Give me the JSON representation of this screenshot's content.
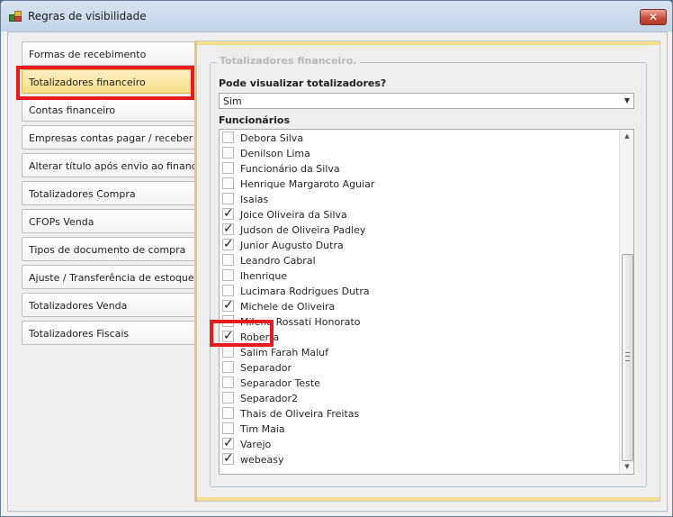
{
  "window": {
    "title": "Regras de visibilidade",
    "close_label": "✕"
  },
  "nav": {
    "items": [
      {
        "label": "Formas de recebimento"
      },
      {
        "label": "Totalizadores financeiro"
      },
      {
        "label": "Contas financeiro"
      },
      {
        "label": "Empresas contas pagar / receber"
      },
      {
        "label": "Alterar título após envio ao financeiro"
      },
      {
        "label": "Totalizadores Compra"
      },
      {
        "label": "CFOPs Venda"
      },
      {
        "label": "Tipos de documento de compra"
      },
      {
        "label": "Ajuste / Transferência de estoque"
      },
      {
        "label": "Totalizadores Venda"
      },
      {
        "label": "Totalizadores Fiscais"
      }
    ],
    "selected": "Totalizadores financeiro"
  },
  "panel": {
    "group_title": "Totalizadores financeiro.",
    "question_label": "Pode visualizar totalizadores?",
    "combo_value": "Sim",
    "employees_label": "Funcionários",
    "employees": [
      {
        "name": "Debora Silva",
        "checked": false
      },
      {
        "name": "Denilson Lima",
        "checked": false
      },
      {
        "name": "Funcionário da Silva",
        "checked": false
      },
      {
        "name": "Henrique Margaroto Aguiar",
        "checked": false
      },
      {
        "name": "Isaias",
        "checked": false
      },
      {
        "name": "Joice Oliveira da Silva",
        "checked": true
      },
      {
        "name": "Judson de Oliveira Padley",
        "checked": true
      },
      {
        "name": "Junior Augusto Dutra",
        "checked": true
      },
      {
        "name": "Leandro Cabral",
        "checked": false
      },
      {
        "name": "lhenrique",
        "checked": false
      },
      {
        "name": "Lucimara Rodrigues Dutra",
        "checked": false
      },
      {
        "name": "Michele de Oliveira",
        "checked": true
      },
      {
        "name": "Milena Rossati Honorato",
        "checked": false
      },
      {
        "name": "Roberta",
        "checked": true
      },
      {
        "name": "Salim Farah Maluf",
        "checked": false
      },
      {
        "name": "Separador",
        "checked": false
      },
      {
        "name": "Separador Teste",
        "checked": false
      },
      {
        "name": "Separador2",
        "checked": false
      },
      {
        "name": "Thais de Oliveira Freitas",
        "checked": false
      },
      {
        "name": "Tim Maia",
        "checked": false
      },
      {
        "name": "Varejo",
        "checked": true
      },
      {
        "name": "webeasy",
        "checked": true
      }
    ],
    "highlighted_employee": "Roberta"
  },
  "colors": {
    "highlight_border": "#e8191f",
    "selected_tab": "#f8dd86",
    "panel_accent": "#f3dd8f"
  }
}
